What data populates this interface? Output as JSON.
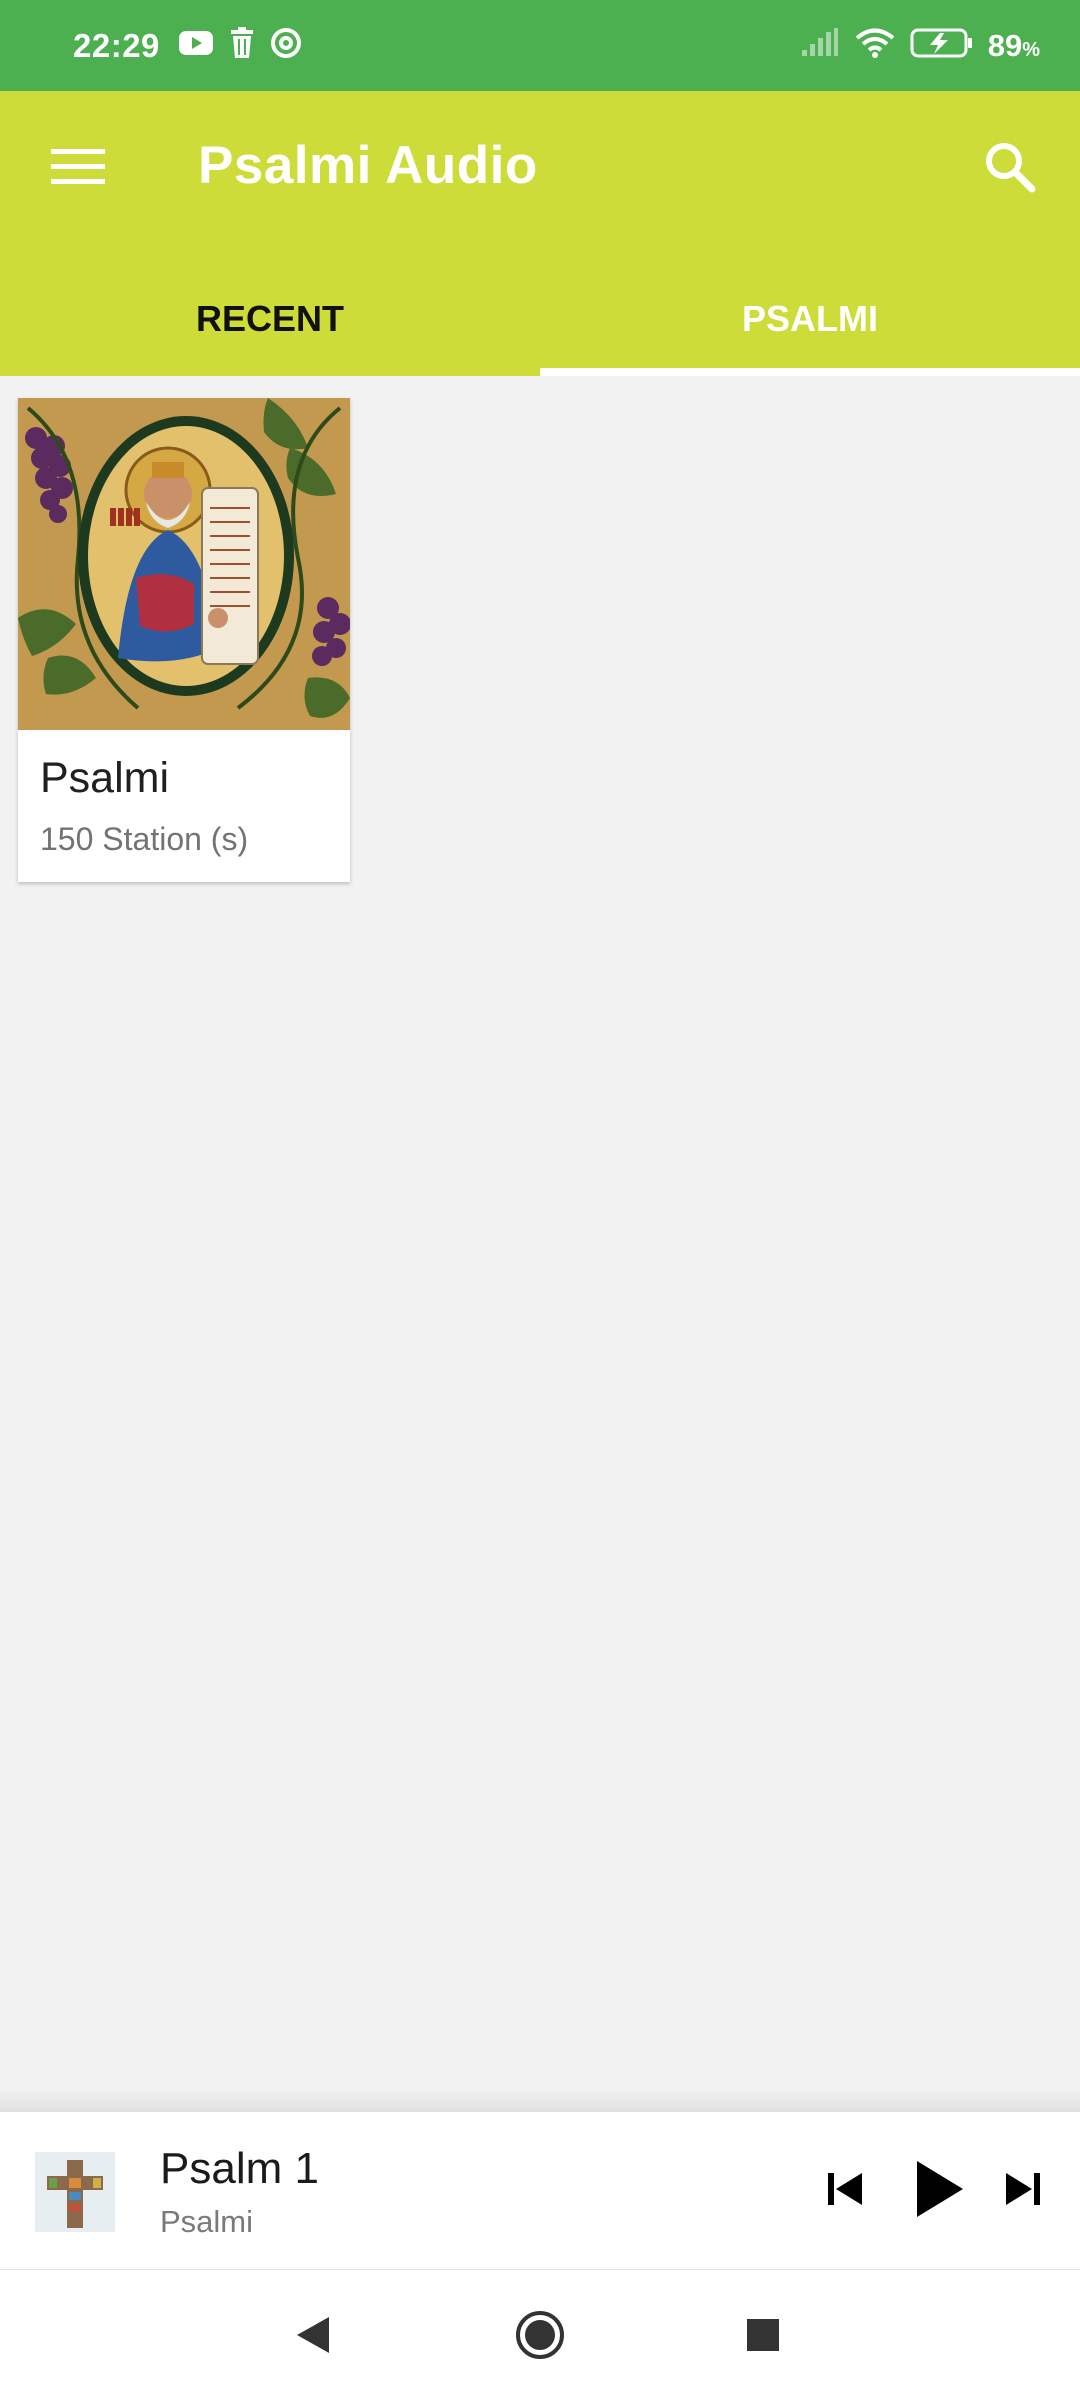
{
  "status_bar": {
    "time": "22:29",
    "left_icons": [
      "youtube-icon",
      "trash-icon",
      "at-sign-icon"
    ],
    "right_icons": [
      "signal-icon",
      "wifi-icon",
      "battery-charging-icon"
    ],
    "battery_percent": "89",
    "battery_unit": "%",
    "background_color": "#4caf50"
  },
  "app_bar": {
    "title": "Psalmi Audio",
    "menu_icon": "hamburger-menu-icon",
    "search_icon": "search-icon",
    "background_color": "#cddc39"
  },
  "tabs": [
    {
      "label": "RECENT",
      "selected": false
    },
    {
      "label": "PSALMI",
      "selected": true
    }
  ],
  "cards": [
    {
      "image": "psalmist-icon-painting",
      "title": "Psalmi",
      "subtitle": "150 Station (s)"
    }
  ],
  "player": {
    "thumbnail": "cross-icon",
    "title": "Psalm 1",
    "subtitle": "Psalmi",
    "controls": [
      "skip-previous-icon",
      "play-icon",
      "skip-next-icon"
    ]
  },
  "nav_bar": {
    "buttons": [
      "back-icon",
      "home-icon",
      "recents-icon"
    ]
  }
}
